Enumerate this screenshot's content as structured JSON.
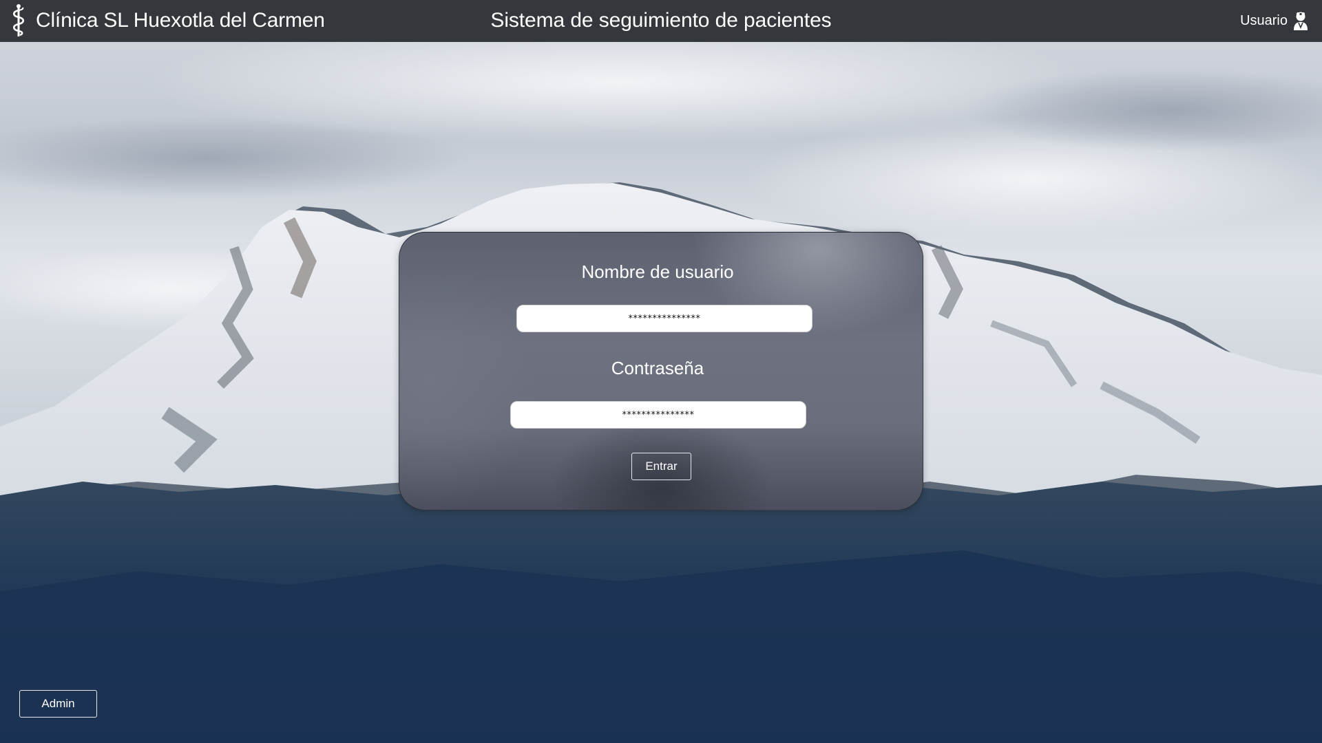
{
  "header": {
    "clinic_name": "Clínica SL Huexotla del Carmen",
    "app_title": "Sistema de seguimiento de pacientes",
    "user_label": "Usuario",
    "brand_icon": "caduceus-icon",
    "user_icon": "doctor-user-icon"
  },
  "login": {
    "username_label": "Nombre de usuario",
    "username_value": "***************",
    "password_label": "Contraseña",
    "password_value": "***************",
    "submit_label": "Entrar"
  },
  "footer": {
    "admin_label": "Admin"
  },
  "colors": {
    "topbar": "#34373b",
    "panel": "#6a6e7c",
    "text": "#ffffff"
  }
}
